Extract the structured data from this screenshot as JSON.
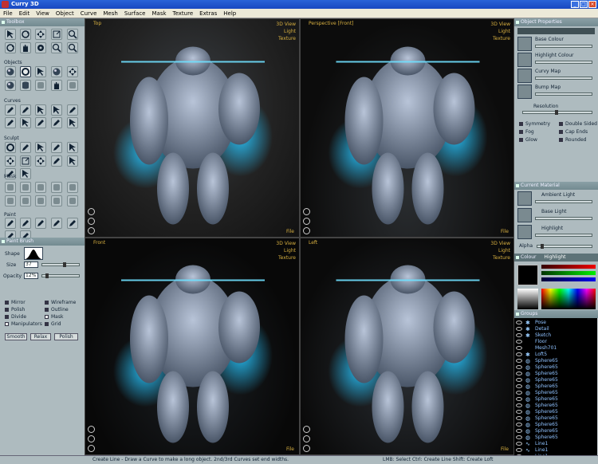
{
  "window": {
    "title": "Curry 3D",
    "minimize": "_",
    "maximize": "□",
    "close": "×"
  },
  "menu": [
    "File",
    "Edit",
    "View",
    "Object",
    "Curve",
    "Mesh",
    "Surface",
    "Mask",
    "Texture",
    "Extras",
    "Help"
  ],
  "toolbox": {
    "title": "Toolbox",
    "sections": {
      "objects": "Objects",
      "curves": "Curves",
      "sculpt": "Sculpt",
      "mask": "Mask",
      "paint": "Paint"
    }
  },
  "paint_brush": {
    "title": "Paint Brush",
    "shape_label": "Shape",
    "size_label": "Size",
    "size_value": "37",
    "opacity_label": "Opacity",
    "opacity_value": "12%",
    "checks": [
      {
        "label": "Mirror",
        "checked": false
      },
      {
        "label": "Wireframe",
        "checked": false
      },
      {
        "label": "Polish",
        "checked": false
      },
      {
        "label": "Outline",
        "checked": false
      },
      {
        "label": "Divide",
        "checked": false
      },
      {
        "label": "Mask",
        "checked": true
      },
      {
        "label": "Manipulators",
        "checked": true
      },
      {
        "label": "Grid",
        "checked": false
      }
    ],
    "buttons": [
      "Smooth",
      "Relax",
      "Polish"
    ]
  },
  "viewports": [
    {
      "label": "Top",
      "menu": [
        "3D View",
        "Light",
        "Texture"
      ],
      "file": "File"
    },
    {
      "label": "Perspective [Front]",
      "menu": [
        "3D View",
        "Light",
        "Texture"
      ],
      "file": "File"
    },
    {
      "label": "Front",
      "menu": [
        "3D View",
        "Light",
        "Texture"
      ],
      "file": "File"
    },
    {
      "label": "Left",
      "menu": [
        "3D View",
        "Light",
        "Texture"
      ],
      "file": "File"
    }
  ],
  "object_properties": {
    "title": "Object Properties",
    "swatches": [
      "Base Colour",
      "Highlight Colour",
      "Curvy Map",
      "Bump Map"
    ],
    "resolution_label": "Resolution",
    "checks": [
      {
        "label": "Symmetry",
        "checked": false
      },
      {
        "label": "Double Sided",
        "checked": false
      },
      {
        "label": "Fog",
        "checked": false
      },
      {
        "label": "Cap Ends",
        "checked": false
      },
      {
        "label": "Glow",
        "checked": false
      },
      {
        "label": "Rounded",
        "checked": false
      }
    ]
  },
  "current_material": {
    "title": "Current Material",
    "swatches": [
      "Ambient Light",
      "Base Light",
      "Highlight"
    ],
    "alpha_label": "Alpha"
  },
  "colour": {
    "tab_colour": "Colour",
    "tab_highlight": "Highlight"
  },
  "groups": {
    "title": "Groups",
    "items": [
      {
        "name": "Pose",
        "icon": "star"
      },
      {
        "name": "Detail",
        "icon": "star"
      },
      {
        "name": "Sketch",
        "icon": "star"
      },
      {
        "name": "Floor",
        "icon": "none"
      },
      {
        "name": "Mesh701",
        "icon": "none"
      },
      {
        "name": "Loft5",
        "icon": "star"
      },
      {
        "name": "Sphere65",
        "icon": "sphere"
      },
      {
        "name": "Sphere65",
        "icon": "sphere"
      },
      {
        "name": "Sphere65",
        "icon": "sphere"
      },
      {
        "name": "Sphere65",
        "icon": "sphere"
      },
      {
        "name": "Sphere65",
        "icon": "sphere"
      },
      {
        "name": "Sphere65",
        "icon": "sphere"
      },
      {
        "name": "Sphere65",
        "icon": "sphere"
      },
      {
        "name": "Sphere65",
        "icon": "sphere"
      },
      {
        "name": "Sphere65",
        "icon": "sphere"
      },
      {
        "name": "Sphere65",
        "icon": "sphere"
      },
      {
        "name": "Sphere65",
        "icon": "sphere"
      },
      {
        "name": "Sphere65",
        "icon": "sphere"
      },
      {
        "name": "Sphere65",
        "icon": "sphere"
      },
      {
        "name": "Line1",
        "icon": "line"
      },
      {
        "name": "Line1",
        "icon": "line"
      },
      {
        "name": "Line1",
        "icon": "line"
      }
    ]
  },
  "status": {
    "left": "Create Line - Draw a Curve to make a long object. 2nd/3rd Curves set end widths.",
    "right": "LMB: Select  Ctrl: Create Line  Shift: Create Loft"
  },
  "colors": {
    "accent": "#2a63d8",
    "panel": "#aebbbf",
    "glow": "#27c6ff"
  }
}
